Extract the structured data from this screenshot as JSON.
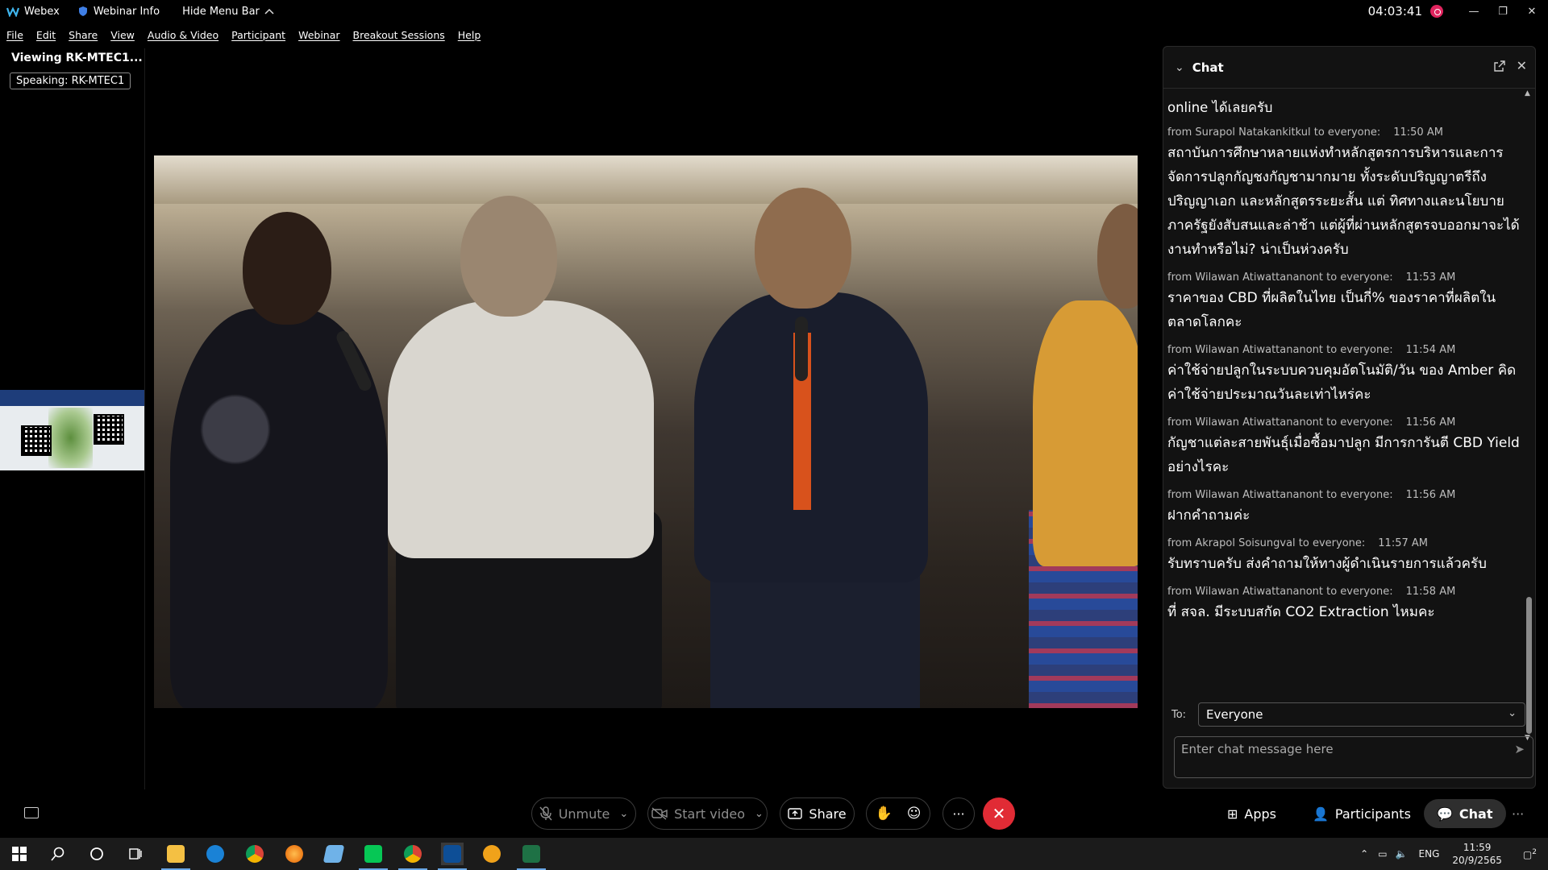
{
  "titlebar": {
    "app_name": "Webex",
    "webinar_info": "Webinar Info",
    "hide_menu": "Hide Menu Bar",
    "time": "04:03:41",
    "minimize": "—",
    "restore": "❐",
    "close": "✕"
  },
  "menu": [
    "File",
    "Edit",
    "Share",
    "View",
    "Audio & Video",
    "Participant",
    "Webinar",
    "Breakout Sessions",
    "Help"
  ],
  "left_panel": {
    "viewing": "Viewing RK-MTEC1...",
    "speaking": "Speaking: RK-MTEC1"
  },
  "chat": {
    "title": "Chat",
    "first_message": "online ได้เลยครับ",
    "messages": [
      {
        "from": "from Surapol Natakankitkul to everyone:",
        "time": "11:50 AM",
        "text": "สถาบันการศึกษาหลายแห่งทำหลักสูตรการบริหารและการจัดการปลูกกัญชงกัญชามากมาย ทั้งระดับปริญญาตรีถึงปริญญาเอก และหลักสูตรระยะสั้น แต่ ทิศทางและนโยบายภาครัฐยังสับสนและล่าช้า แต่ผู้ที่ผ่านหลักสูตรจบออกมาจะได้งานทำหรือไม่? น่าเป็นห่วงครับ"
      },
      {
        "from": "from Wilawan Atiwattananont to everyone:",
        "time": "11:53 AM",
        "text": "ราคาของ CBD ที่ผลิตในไทย เป็นกี่% ของราคาที่ผลิตในตลาดโลกคะ"
      },
      {
        "from": "from Wilawan Atiwattananont to everyone:",
        "time": "11:54 AM",
        "text": "ค่าใช้จ่ายปลูกในระบบควบคุมอัตโนมัติ/วัน ของ Amber คิดค่าใช้จ่ายประมาณวันละเท่าไหร่คะ"
      },
      {
        "from": "from Wilawan Atiwattananont to everyone:",
        "time": "11:56 AM",
        "text": "กัญชาแต่ละสายพันธุ์เมื่อซื้อมาปลูก มีการการันตี CBD Yield อย่างไรคะ"
      },
      {
        "from": "from Wilawan Atiwattananont to everyone:",
        "time": "11:56 AM",
        "text": "ฝากคำถามค่ะ"
      },
      {
        "from": "from Akrapol Soisungval to everyone:",
        "time": "11:57 AM",
        "text": "รับทราบครับ ส่งคำถามให้ทางผู้ดำเนินรายการแล้วครับ"
      },
      {
        "from": "from Wilawan Atiwattananont to everyone:",
        "time": "11:58 AM",
        "text": "ที่ สจล. มีระบบสกัด CO2 Extraction ไหมคะ"
      }
    ],
    "to_label": "To:",
    "to_value": "Everyone",
    "input_placeholder": "Enter chat message here"
  },
  "controls": {
    "unmute": "Unmute",
    "start_video": "Start video",
    "share": "Share",
    "more": "···",
    "apps": "Apps",
    "participants": "Participants",
    "chat": "Chat",
    "overflow": "···"
  },
  "taskbar": {
    "lang": "ENG",
    "time": "11:59",
    "date": "20/9/2565",
    "notification_count": "2"
  },
  "colors": {
    "end_call": "#e12b35",
    "recording": "#e0245e",
    "chat_panel": "#121212"
  }
}
